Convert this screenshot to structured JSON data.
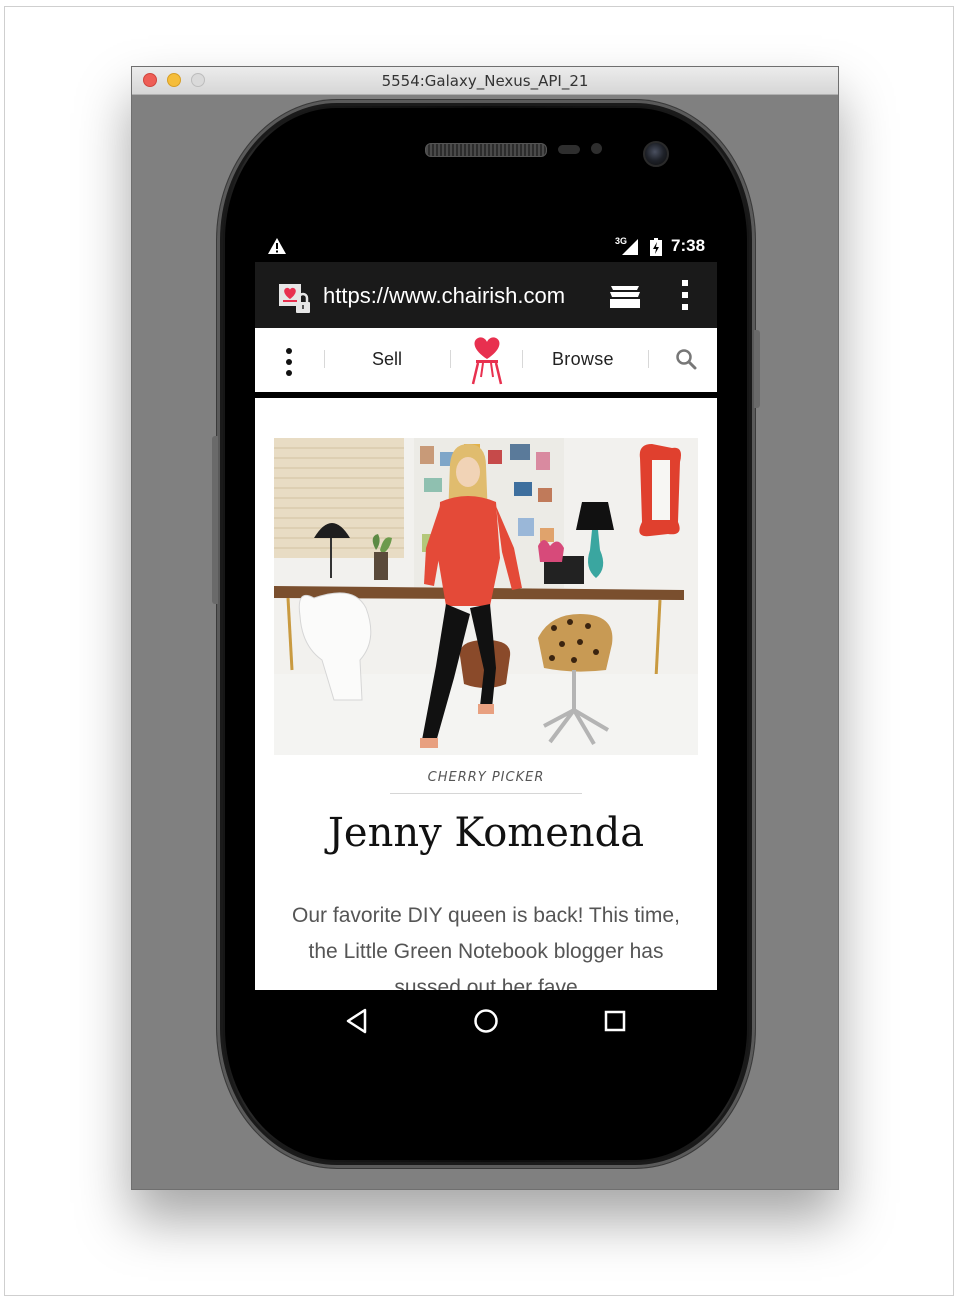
{
  "window": {
    "title": "5554:Galaxy_Nexus_API_21"
  },
  "status_bar": {
    "time": "7:38",
    "network": "3G",
    "icons": [
      "warning-icon",
      "signal-icon",
      "battery-icon"
    ]
  },
  "browser": {
    "url": "https://www.chairish.com",
    "icons": [
      "secure-lock-icon",
      "tabs-icon",
      "overflow-menu-icon"
    ]
  },
  "site_nav": {
    "sell_label": "Sell",
    "browse_label": "Browse",
    "brand_color": "#e8304f",
    "icons": [
      "menu-icon",
      "chairish-logo-icon",
      "search-icon"
    ]
  },
  "article": {
    "image": "photo-woman-in-home-office",
    "kicker": "CHERRY PICKER",
    "headline": "Jenny Komenda",
    "dek": "Our favorite DIY queen is back! This time, the Little Green Notebook blogger has sussed out her fave"
  },
  "android_nav": {
    "icons": [
      "back-icon",
      "home-icon",
      "recents-icon"
    ]
  }
}
